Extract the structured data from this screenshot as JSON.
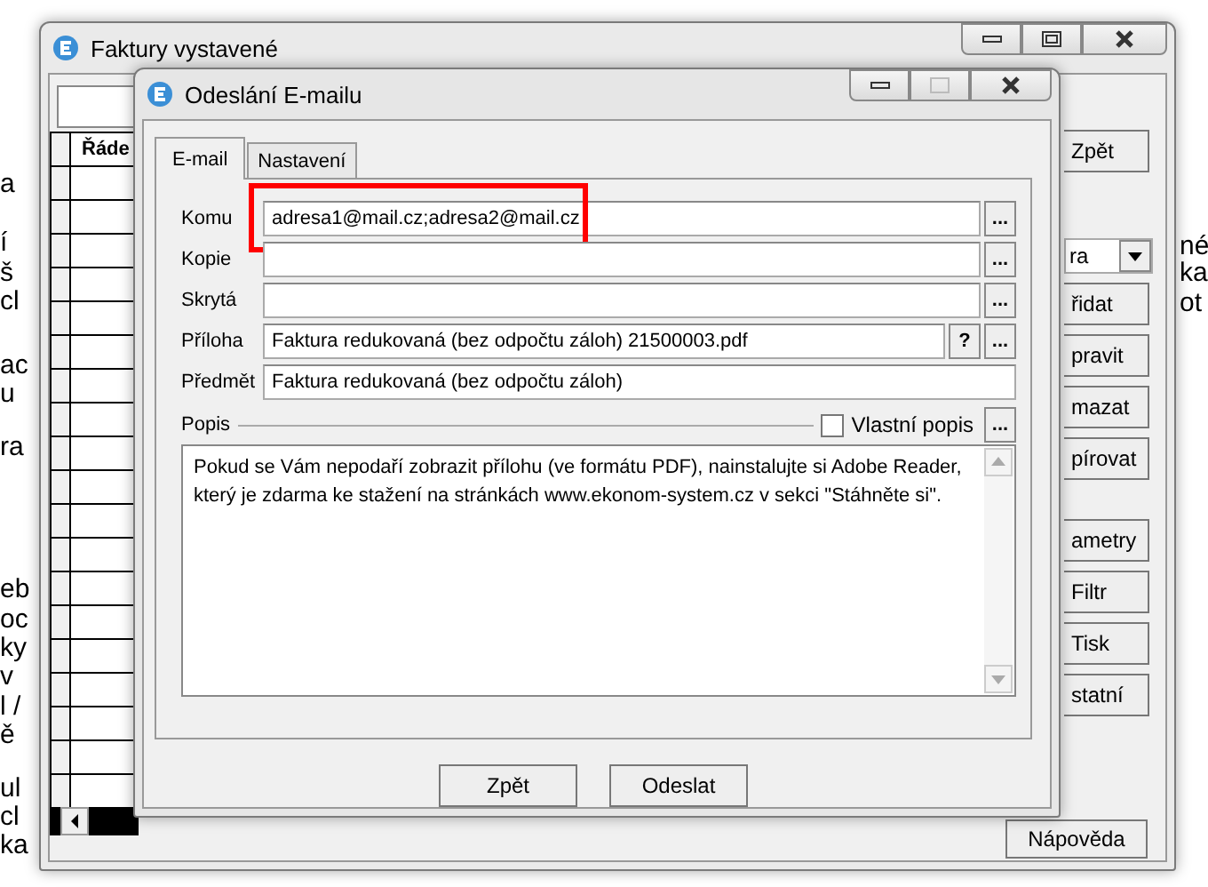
{
  "back_window": {
    "title": "Faktury vystavené",
    "table_header": "Řáde",
    "buttons": [
      {
        "label": "Zpět"
      },
      {
        "label": "řidat"
      },
      {
        "label": "pravit"
      },
      {
        "label": "mazat"
      },
      {
        "label": "pírovat"
      },
      {
        "label": "ametry"
      },
      {
        "label": "Filtr"
      },
      {
        "label": "Tisk"
      },
      {
        "label": "statní"
      }
    ],
    "dropdown": {
      "value": "ra"
    },
    "help_button": "Nápověda"
  },
  "left_fragments": [
    {
      "text": "a"
    },
    {
      "text": "í"
    },
    {
      "text": "š"
    },
    {
      "text": "cl"
    },
    {
      "text": "ac"
    },
    {
      "text": "u"
    },
    {
      "text": "ra"
    },
    {
      "text": "eb"
    },
    {
      "text": "oc"
    },
    {
      "text": "ky"
    },
    {
      "text": "v"
    },
    {
      "text": "l /"
    },
    {
      "text": "ě"
    },
    {
      "text": "ul"
    },
    {
      "text": "cl"
    },
    {
      "text": "ka"
    }
  ],
  "right_fragments": [
    {
      "text": "né"
    },
    {
      "text": "ka"
    },
    {
      "text": "ot"
    }
  ],
  "dialog": {
    "title": "Odeslání E-mailu",
    "tabs": [
      {
        "label": "E-mail",
        "selected": true
      },
      {
        "label": "Nastavení",
        "selected": false
      }
    ],
    "fields": [
      {
        "label": "Komu",
        "value": "adresa1@mail.cz;adresa2@mail.cz",
        "kind": "browse",
        "highlighted": true
      },
      {
        "label": "Kopie",
        "kind": "browse",
        "highlighted": false
      },
      {
        "label": "Skrytá",
        "kind": "browse",
        "highlighted": false
      },
      {
        "label": "Příloha",
        "value": "Faktura redukovaná (bez odpočtu záloh) 21500003.pdf",
        "kind": "attachment",
        "highlighted": false
      },
      {
        "label": "Předmět",
        "value": "Faktura redukovaná (bez odpočtu záloh)",
        "kind": "plain",
        "highlighted": false
      }
    ],
    "browse_label": "...",
    "help_label": "?",
    "description": {
      "label": "Popis",
      "custom_label": "Vlastní popis",
      "custom_checked": false,
      "text": "Pokud se Vám nepodaří zobrazit přílohu (ve formátu PDF), nainstalujte si Adobe Reader, který je zdarma ke stažení na stránkách www.ekonom-system.cz v sekci \"Stáhněte si\"."
    },
    "buttons": [
      "Zpět",
      "Odeslat"
    ]
  }
}
